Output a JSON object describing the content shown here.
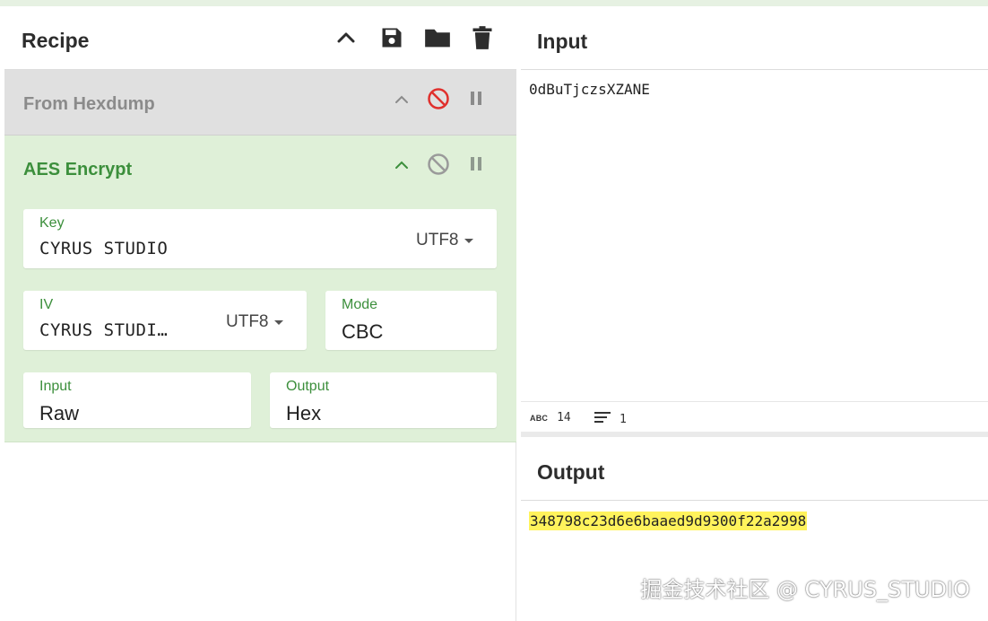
{
  "recipe": {
    "title": "Recipe",
    "header_icons": [
      "chevron-up-icon",
      "save-icon",
      "folder-icon",
      "trash-icon"
    ],
    "operations": [
      {
        "name": "From Hexdump",
        "disabled": true,
        "icons": [
          "chevron-up-icon",
          "disable-icon",
          "pause-icon"
        ]
      },
      {
        "name": "AES Encrypt",
        "disabled": false,
        "icons": [
          "chevron-up-icon",
          "disable-icon",
          "pause-icon"
        ],
        "fields": {
          "key": {
            "label": "Key",
            "value": "CYRUS STUDIO",
            "encoding": "UTF8"
          },
          "iv": {
            "label": "IV",
            "value": "CYRUS STUDI…",
            "encoding": "UTF8"
          },
          "mode": {
            "label": "Mode",
            "value": "CBC"
          },
          "input": {
            "label": "Input",
            "value": "Raw"
          },
          "output": {
            "label": "Output",
            "value": "Hex"
          }
        }
      }
    ]
  },
  "input": {
    "title": "Input",
    "text": "0dBuTjczsXZANE",
    "status": {
      "abc_label": "ABC",
      "length": "14",
      "lines": "1"
    }
  },
  "output": {
    "title": "Output",
    "text": "348798c23d6e6baaed9d9300f22a2998"
  },
  "watermark": "掘金技术社区 @ CYRUS_STUDIO",
  "colors": {
    "accent_green": "#3c8f3c",
    "active_op_bg": "#dff0d8",
    "disabled_op_bg": "#e0e0e0",
    "disable_red": "#e0302d",
    "highlight": "#fff35c"
  }
}
